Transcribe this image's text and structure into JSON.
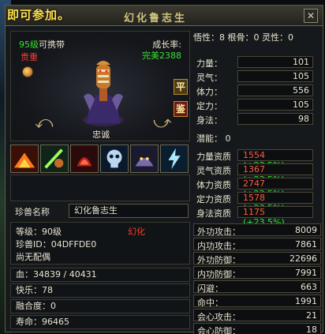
{
  "title_left": "即可参加。",
  "window_title": "幻化鲁志生",
  "close_icon": "close-icon",
  "portrait": {
    "level_prefix": "95级",
    "level_suffix": "可携带",
    "rarity": "贵重",
    "growth_label": "成长率:",
    "growth_value": "完美2388",
    "char_name": "忠诚",
    "btn_ping": "平",
    "btn_jian": "鉴"
  },
  "skills": [
    "skill-fire",
    "skill-green-slash",
    "skill-blood",
    "skill-skull",
    "skill-beast",
    "skill-bolt"
  ],
  "pet_name_label": "珍兽名称",
  "pet_name_value": "幻化鲁志生",
  "info": {
    "level": "等级：90级",
    "huahua": "幻化",
    "id": "珍兽ID：04DFFDE0",
    "spouse": "尚无配偶"
  },
  "blood": "血：34839 / 40431",
  "happy": "快乐：78",
  "fusion": "融合度：0",
  "lifespan": "寿命：96465",
  "header_stats": "悟性：8  根骨：0  灵性：0",
  "attributes": [
    {
      "label": "力量：",
      "value": "101"
    },
    {
      "label": "灵气：",
      "value": "105"
    },
    {
      "label": "体力：",
      "value": "556"
    },
    {
      "label": "定力：",
      "value": "105"
    },
    {
      "label": "身法：",
      "value": "98"
    }
  ],
  "potential": "潜能：   0",
  "qualities": [
    {
      "label": "力量资质",
      "value": "1554",
      "pct": "(+23.5%)"
    },
    {
      "label": "灵气资质",
      "value": "1367",
      "pct": "(+23.5%)"
    },
    {
      "label": "体力资质",
      "value": "2747",
      "pct": "(+23.5%)"
    },
    {
      "label": "定力资质",
      "value": "1578",
      "pct": "(+23.5%)"
    },
    {
      "label": "身法资质",
      "value": "1175",
      "pct": "(+23.5%)"
    }
  ],
  "combat": [
    {
      "label": "外功攻击：",
      "value": "8009"
    },
    {
      "label": "内功攻击：",
      "value": "7861"
    },
    {
      "label": "外功防御：",
      "value": "22696"
    },
    {
      "label": "内功防御：",
      "value": "7991"
    },
    {
      "label": "闪避：",
      "value": "663"
    },
    {
      "label": "命中：",
      "value": "1991"
    },
    {
      "label": "会心攻击：",
      "value": "21"
    },
    {
      "label": "会心防御：",
      "value": "18"
    }
  ]
}
